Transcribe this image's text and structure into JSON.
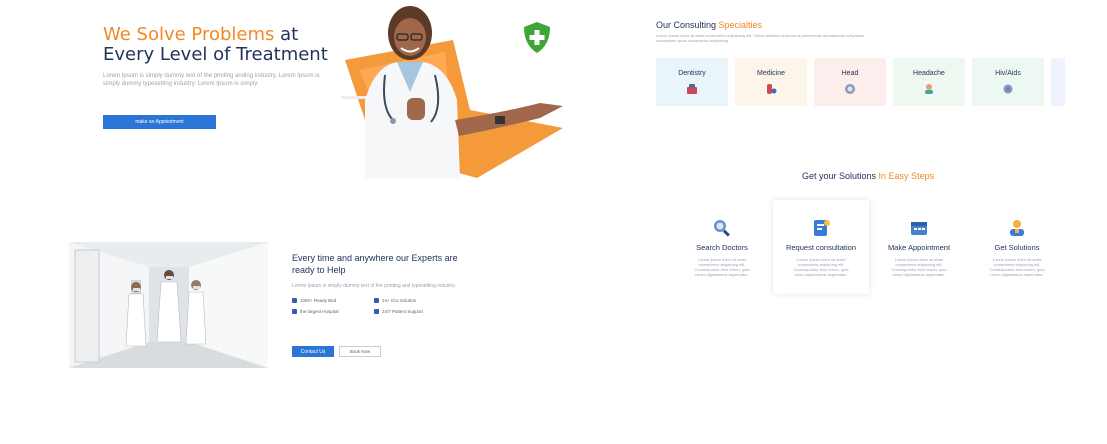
{
  "hero": {
    "title_accent": "We Solve Problems",
    "title_rest": " at Every Level of Treatment",
    "description": "Lorem Ipsum is simply dummy text of the printing anding industry. Lorem Ipsum is simply dummy typesetting industry. Lorem Ipsum is simply.",
    "appointment_button": "make an Appointment"
  },
  "specialties": {
    "title_main": "Our Consulting ",
    "title_accent": "Specialties",
    "description": "Lorem ipsum dolor sit amet consectetur adipiscing elit. Officia debitam ducimus at perferendis repudiandae voluptates consectetur quos consectetur adipisicing.",
    "items": [
      {
        "label": "Dentistry",
        "bg": "#eaf4fb",
        "icon": "dentistry-icon"
      },
      {
        "label": "Medicine",
        "bg": "#fdf5ea",
        "icon": "medicine-icon"
      },
      {
        "label": "Head",
        "bg": "#fdeeee",
        "icon": "head-icon"
      },
      {
        "label": "Headache",
        "bg": "#eef8f1",
        "icon": "headache-icon"
      },
      {
        "label": "Hiv/Aids",
        "bg": "#eef8f2",
        "icon": "hiv-aids-icon"
      }
    ]
  },
  "steps": {
    "title_main": "Get your Solutions ",
    "title_accent": "In Easy Steps",
    "items": [
      {
        "label": "Search Doctors",
        "desc": "Lorem ipsum dolor sit amet consectetur adipiscing elit. Consequuntur eius rerum, quia nemo dignissimos aspernatur.",
        "icon": "search-doctor-icon"
      },
      {
        "label": "Request consultation",
        "desc": "Lorem ipsum dolor sit amet consectetur adipiscing elit. Consequuntur eius rerum, quia nemo dignissimos aspernatur.",
        "icon": "request-consultation-icon"
      },
      {
        "label": "Make Appointment",
        "desc": "Lorem ipsum dolor sit amet consectetur adipiscing elit. Consequuntur eius rerum, quia nemo dignissimos aspernatur.",
        "icon": "calendar-icon"
      },
      {
        "label": "Get Solutions",
        "desc": "Lorem ipsum dolor sit amet consectetur adipiscing elit. Consequuntur eius rerum, quia nemo dignissimos aspernatur.",
        "icon": "doctor-solution-icon"
      }
    ]
  },
  "experts": {
    "title": "Every time and anywhere our Experts are ready to Help",
    "description": "Lorem Ipsum is simply dummy text of the printing and typesetting industry.",
    "features": [
      "1000+ Ready Bed",
      "24+ ICU Solution",
      "the largest Hospital",
      "24/7 Patient Support"
    ],
    "contact_button": "Contact Us",
    "book_button": "Book Now"
  },
  "colors": {
    "accent": "#f08a24",
    "primary": "#2b74d8",
    "heading": "#22345a"
  }
}
